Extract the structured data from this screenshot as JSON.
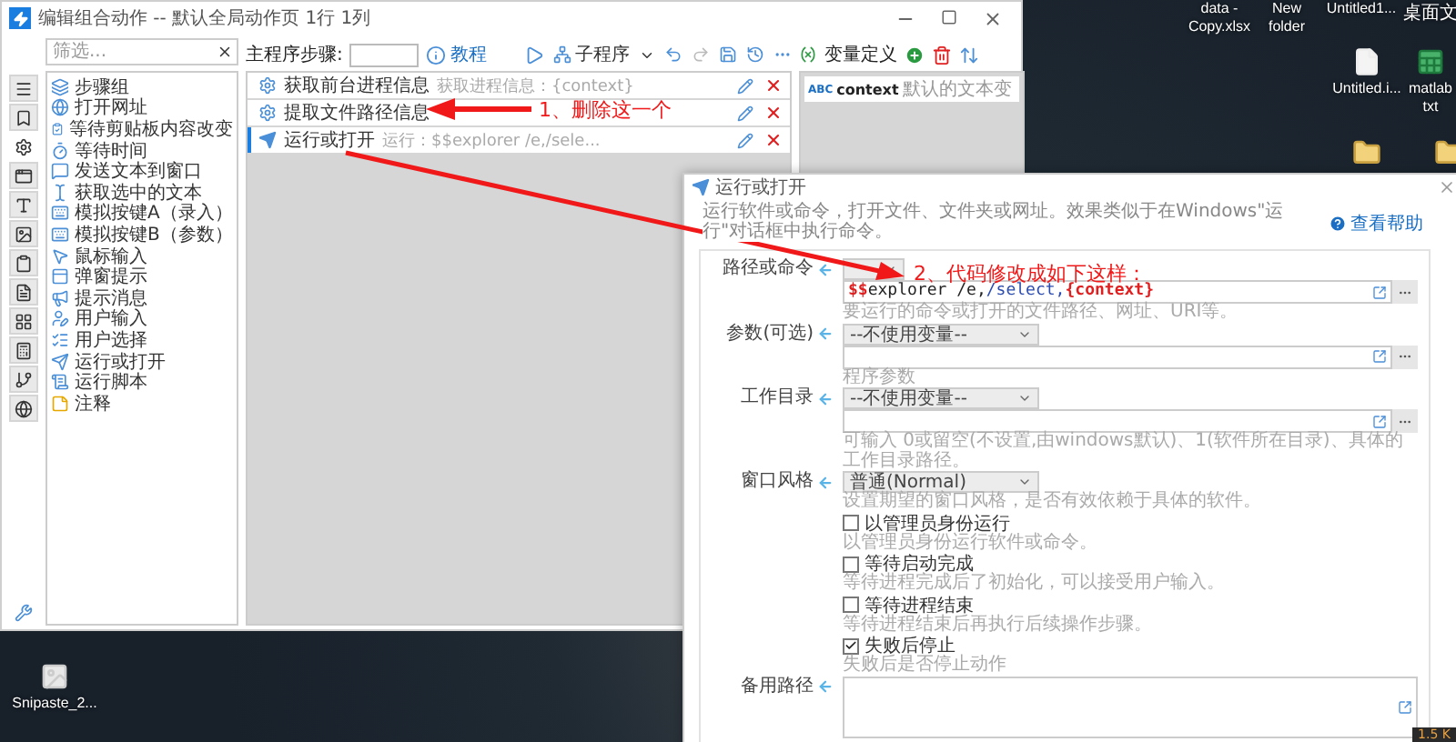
{
  "desktop": {
    "icons": [
      {
        "kind": "none",
        "label": "data - Copy.xlsx"
      },
      {
        "kind": "none",
        "label": "New folder"
      },
      {
        "kind": "none",
        "label": "Untitled1..."
      },
      {
        "kind": "none",
        "label": "桌面文"
      },
      {
        "kind": "document",
        "label": "Untitled.i..."
      },
      {
        "kind": "spreadsheet",
        "label": "matlab txt"
      },
      {
        "kind": "folder"
      },
      {
        "kind": "folder"
      },
      {
        "kind": "image",
        "label": "Snipaste_2..."
      }
    ]
  },
  "main_window": {
    "title": "编辑组合动作 -- 默认全局动作页 1行 1列",
    "side_tabs": [
      {
        "selected": false
      },
      {
        "selected": false
      },
      {
        "selected": true
      },
      {
        "selected": false
      },
      {
        "selected": false
      },
      {
        "selected": false
      },
      {
        "selected": false
      },
      {
        "selected": false
      },
      {
        "selected": false
      },
      {
        "selected": false
      },
      {
        "selected": false
      },
      {
        "selected": false
      }
    ],
    "filter": {
      "placeholder": "筛选..."
    },
    "actions": [
      "步骤组",
      "打开网址",
      "等待剪贴板内容改变",
      "等待时间",
      "发送文本到窗口",
      "获取选中的文本",
      "模拟按键A（录入）",
      "模拟按键B（参数）",
      "鼠标输入",
      "弹窗提示",
      "提示消息",
      "用户输入",
      "用户选择",
      "运行或打开",
      "运行脚本",
      "注释"
    ],
    "steps_label": "主程序步骤:",
    "tutorial": "教程",
    "subprogram": "子程序",
    "steps": [
      {
        "name": "获取前台进程信息",
        "detail": "获取进程信息：{context}",
        "selected": false
      },
      {
        "name": "提取文件路径信息",
        "selected": false
      },
      {
        "name": "运行或打开",
        "detail": "运行：$$explorer /e,/sele...",
        "selected": true
      }
    ],
    "variables": {
      "title": "变量定义",
      "items": [
        {
          "type": "ABC",
          "name": "context",
          "detail": "默认的文本变"
        }
      ]
    }
  },
  "annotations": [
    {
      "text": "1、删除这一个"
    },
    {
      "text": "2、代码修改成如下这样："
    }
  ],
  "dialog": {
    "title": "运行或打开",
    "description": "运行软件或命令，打开文件、文件夹或网址。效果类似于在Windows\"运行\"对话框中执行命令。",
    "help": "查看帮助",
    "fields": [
      {
        "label": "路径或命令",
        "code": [
          {
            "kind": "sigil",
            "text": "$$"
          },
          {
            "kind": "plain",
            "text": "explorer /e,"
          },
          {
            "kind": "switch",
            "text": "/select,"
          },
          {
            "kind": "variable",
            "text": "{context}"
          }
        ],
        "hint": "要运行的命令或打开的文件路径、网址、URI等。"
      },
      {
        "label": "参数(可选)",
        "select": "--不使用变量--",
        "hint": "程序参数"
      },
      {
        "label": "工作目录",
        "select": "--不使用变量--",
        "hint": "可输入 0或留空(不设置,由windows默认)、1(软件所在目录)、具体的工作目录路径。"
      }
    ],
    "window_style": {
      "label": "窗口风格",
      "select": "普通(Normal)",
      "hint": "设置期望的窗口风格，是否有效依赖于具体的软件。"
    },
    "options": [
      {
        "label": "以管理员身份运行",
        "hint": "以管理员身份运行软件或命令。",
        "checked": false
      },
      {
        "label": "等待启动完成",
        "hint": "等待进程完成后了初始化，可以接受用户输入。",
        "checked": false
      },
      {
        "label": "等待进程结束",
        "hint": "等待进程结束后再执行后续操作步骤。",
        "checked": false
      },
      {
        "label": "失败后停止",
        "hint": "失败后是否停止动作",
        "checked": true
      }
    ],
    "backup": {
      "label": "备用路径"
    }
  },
  "tray": {
    "speed": "1.5 K"
  }
}
